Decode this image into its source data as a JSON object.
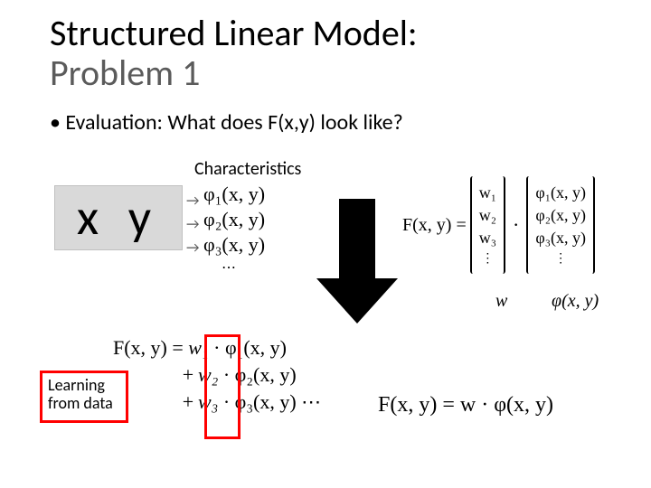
{
  "title": {
    "line1": "Structured Linear Model:",
    "line2": "Problem 1"
  },
  "bullet": "• Evaluation: What does F(x,y) look like?",
  "characteristics_label": "Characteristics",
  "xy": "x  y",
  "phi_list": {
    "p1": "φ₁(x, y)",
    "p2": "φ₂(x, y)",
    "p3": "φ₃(x, y)",
    "dots": "⋯"
  },
  "vector_eq": {
    "lhs": "F(x, y) =",
    "w": {
      "w1": "w₁",
      "w2": "w₂",
      "w3": "w₃",
      "dots": "⋮"
    },
    "dot": "·",
    "phi": {
      "p1": "φ₁(x, y)",
      "p2": "φ₂(x, y)",
      "p3": "φ₃(x, y)",
      "dots": "⋮"
    },
    "w_label": "w",
    "phi_label": "φ(x, y)"
  },
  "lower_eq": {
    "lhs": "F(x, y) =",
    "r1": {
      "w": "w₁",
      "phi": "· φ₁(x, y)"
    },
    "r2": {
      "op": "+",
      "w": "w₂",
      "phi": "· φ₂(x, y)"
    },
    "r3": {
      "op": "+",
      "w": "w₃",
      "phi": "· φ₃(x, y) ⋯"
    }
  },
  "learning_box": "Learning from data",
  "final_eq": "F(x, y) = w · φ(x, y)"
}
